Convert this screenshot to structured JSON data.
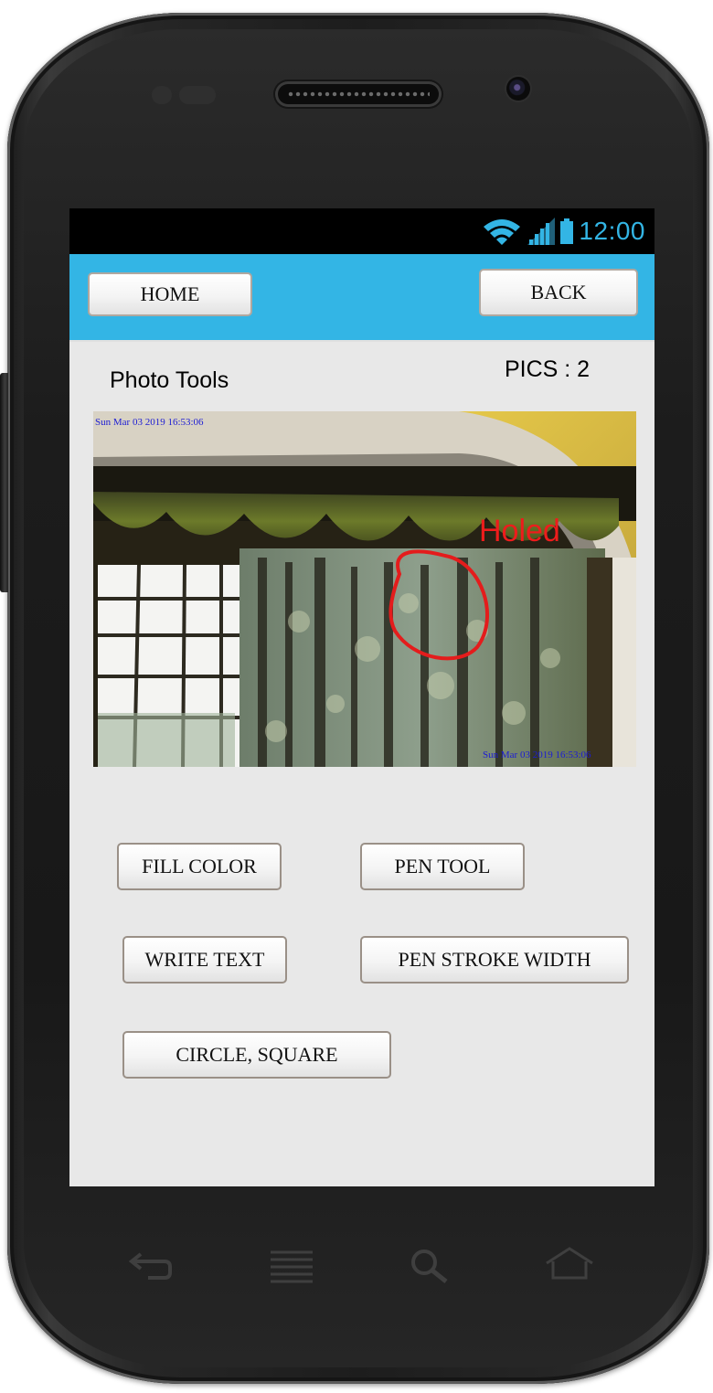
{
  "status_bar": {
    "time": "12:00",
    "wifi_icon": "wifi-icon",
    "signal_icon": "signal-icon",
    "battery_icon": "battery-icon",
    "accent_color": "#33b5e5"
  },
  "header": {
    "home_label": "HOME",
    "back_label": "BACK",
    "background_color": "#33b5e5"
  },
  "page": {
    "title": "Photo Tools",
    "pics_count": "PICS : 2"
  },
  "photo": {
    "timestamp_top": "Sun Mar 03 2019 16:53:06",
    "timestamp_bottom": "Sun Mar 03 2019 16:53:06",
    "annotation_text": "Holed",
    "annotation_color": "#ee1c1c"
  },
  "tools": {
    "fill_color": "FILL COLOR",
    "pen_tool": "PEN TOOL",
    "write_text": "WRITE TEXT",
    "pen_stroke_width": "PEN STROKE WIDTH",
    "circle_square": "CIRCLE, SQUARE"
  },
  "nav_keys": {
    "back": "back-arrow-icon",
    "menu": "menu-icon",
    "search": "search-icon",
    "home": "home-icon"
  }
}
